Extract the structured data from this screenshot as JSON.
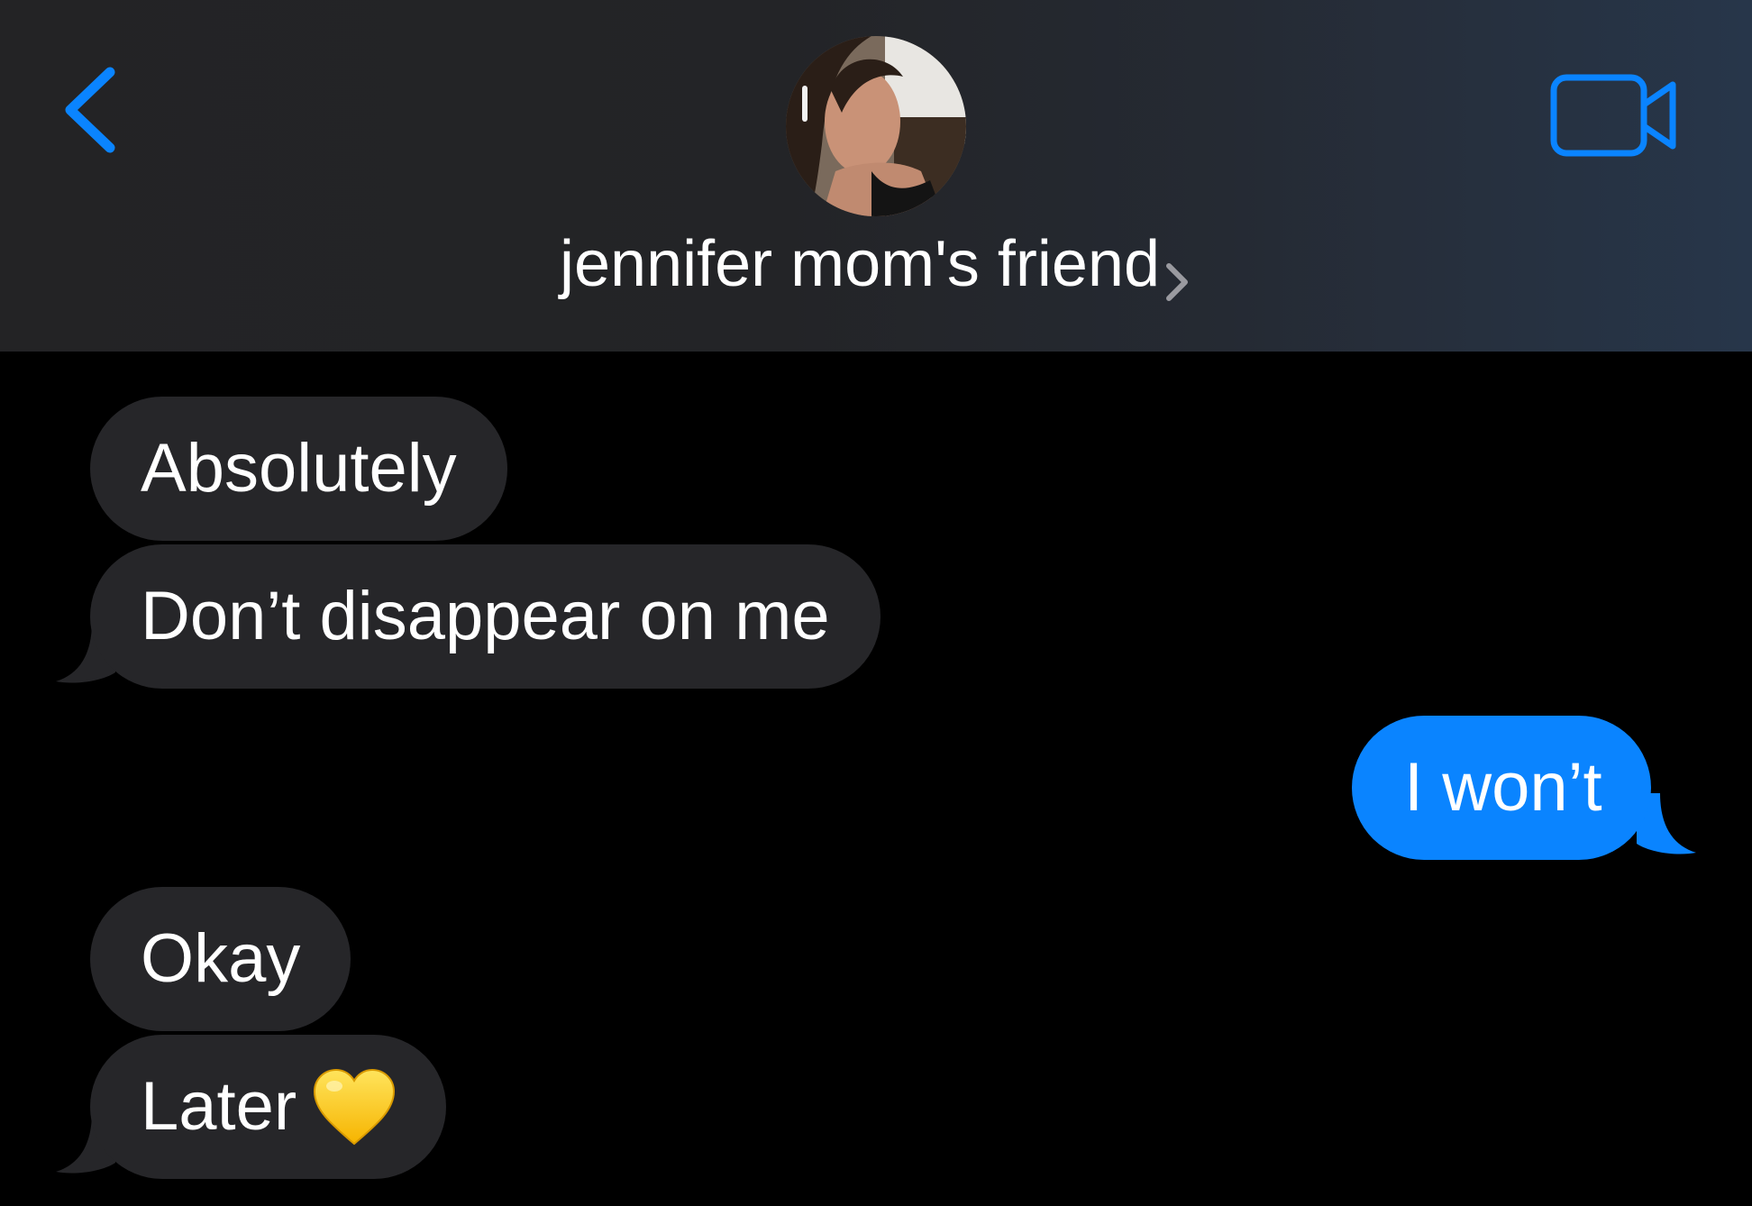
{
  "header": {
    "contact_name": "jennifer mom's friend",
    "back_icon": "chevron-left-icon",
    "video_icon": "video-camera-icon",
    "accent_color": "#0a84ff"
  },
  "messages": [
    {
      "direction": "incoming",
      "text": "Absolutely"
    },
    {
      "direction": "incoming",
      "text": "Don’t disappear on me"
    },
    {
      "direction": "outgoing",
      "text": "I won’t"
    },
    {
      "direction": "incoming",
      "text": "Okay"
    },
    {
      "direction": "incoming",
      "text": "Later",
      "emoji": "yellow-heart"
    }
  ],
  "colors": {
    "incoming_bubble": "#262629",
    "outgoing_bubble": "#0a84ff",
    "background": "#000000"
  }
}
